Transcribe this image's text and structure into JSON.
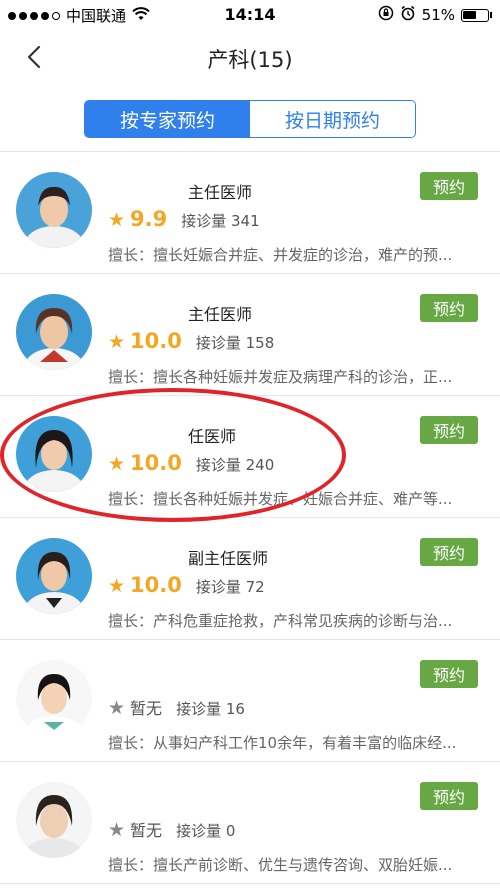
{
  "status_bar": {
    "carrier": "中国联通",
    "time": "14:14",
    "battery": "51%"
  },
  "nav": {
    "title": "产科(15)"
  },
  "tabs": [
    {
      "label": "按专家预约",
      "active": true
    },
    {
      "label": "按日期预约",
      "active": false
    }
  ],
  "book_label": "预约",
  "doctors": [
    {
      "title": "主任医师",
      "score": "9.9",
      "consult": "接诊量 341",
      "desc": "擅长：擅长妊娠合并症、并发症的诊治，难产的预..."
    },
    {
      "title": "主任医师",
      "score": "10.0",
      "consult": "接诊量 158",
      "desc": "擅长：擅长各种妊娠并发症及病理产科的诊治，正..."
    },
    {
      "title": "任医师",
      "score": "10.0",
      "consult": "接诊量 240",
      "desc": "擅长：擅长各种妊娠并发症、妊娠合并症、难产等..."
    },
    {
      "title": "副主任医师",
      "score": "10.0",
      "consult": "接诊量 72",
      "desc": "擅长：产科危重症抢救，产科常见疾病的诊断与治..."
    },
    {
      "title": "",
      "score": "暂无",
      "consult": "接诊量 16",
      "desc": "擅长：从事妇产科工作10余年，有着丰富的临床经..."
    },
    {
      "title": "",
      "score": "暂无",
      "consult": "接诊量 0",
      "desc": "擅长：擅长产前诊断、优生与遗传咨询、双胎妊娠..."
    }
  ],
  "colors": {
    "accent": "#2f80ed",
    "book_green": "#67a845",
    "star": "#f5a623",
    "highlight": "#e0242a"
  }
}
